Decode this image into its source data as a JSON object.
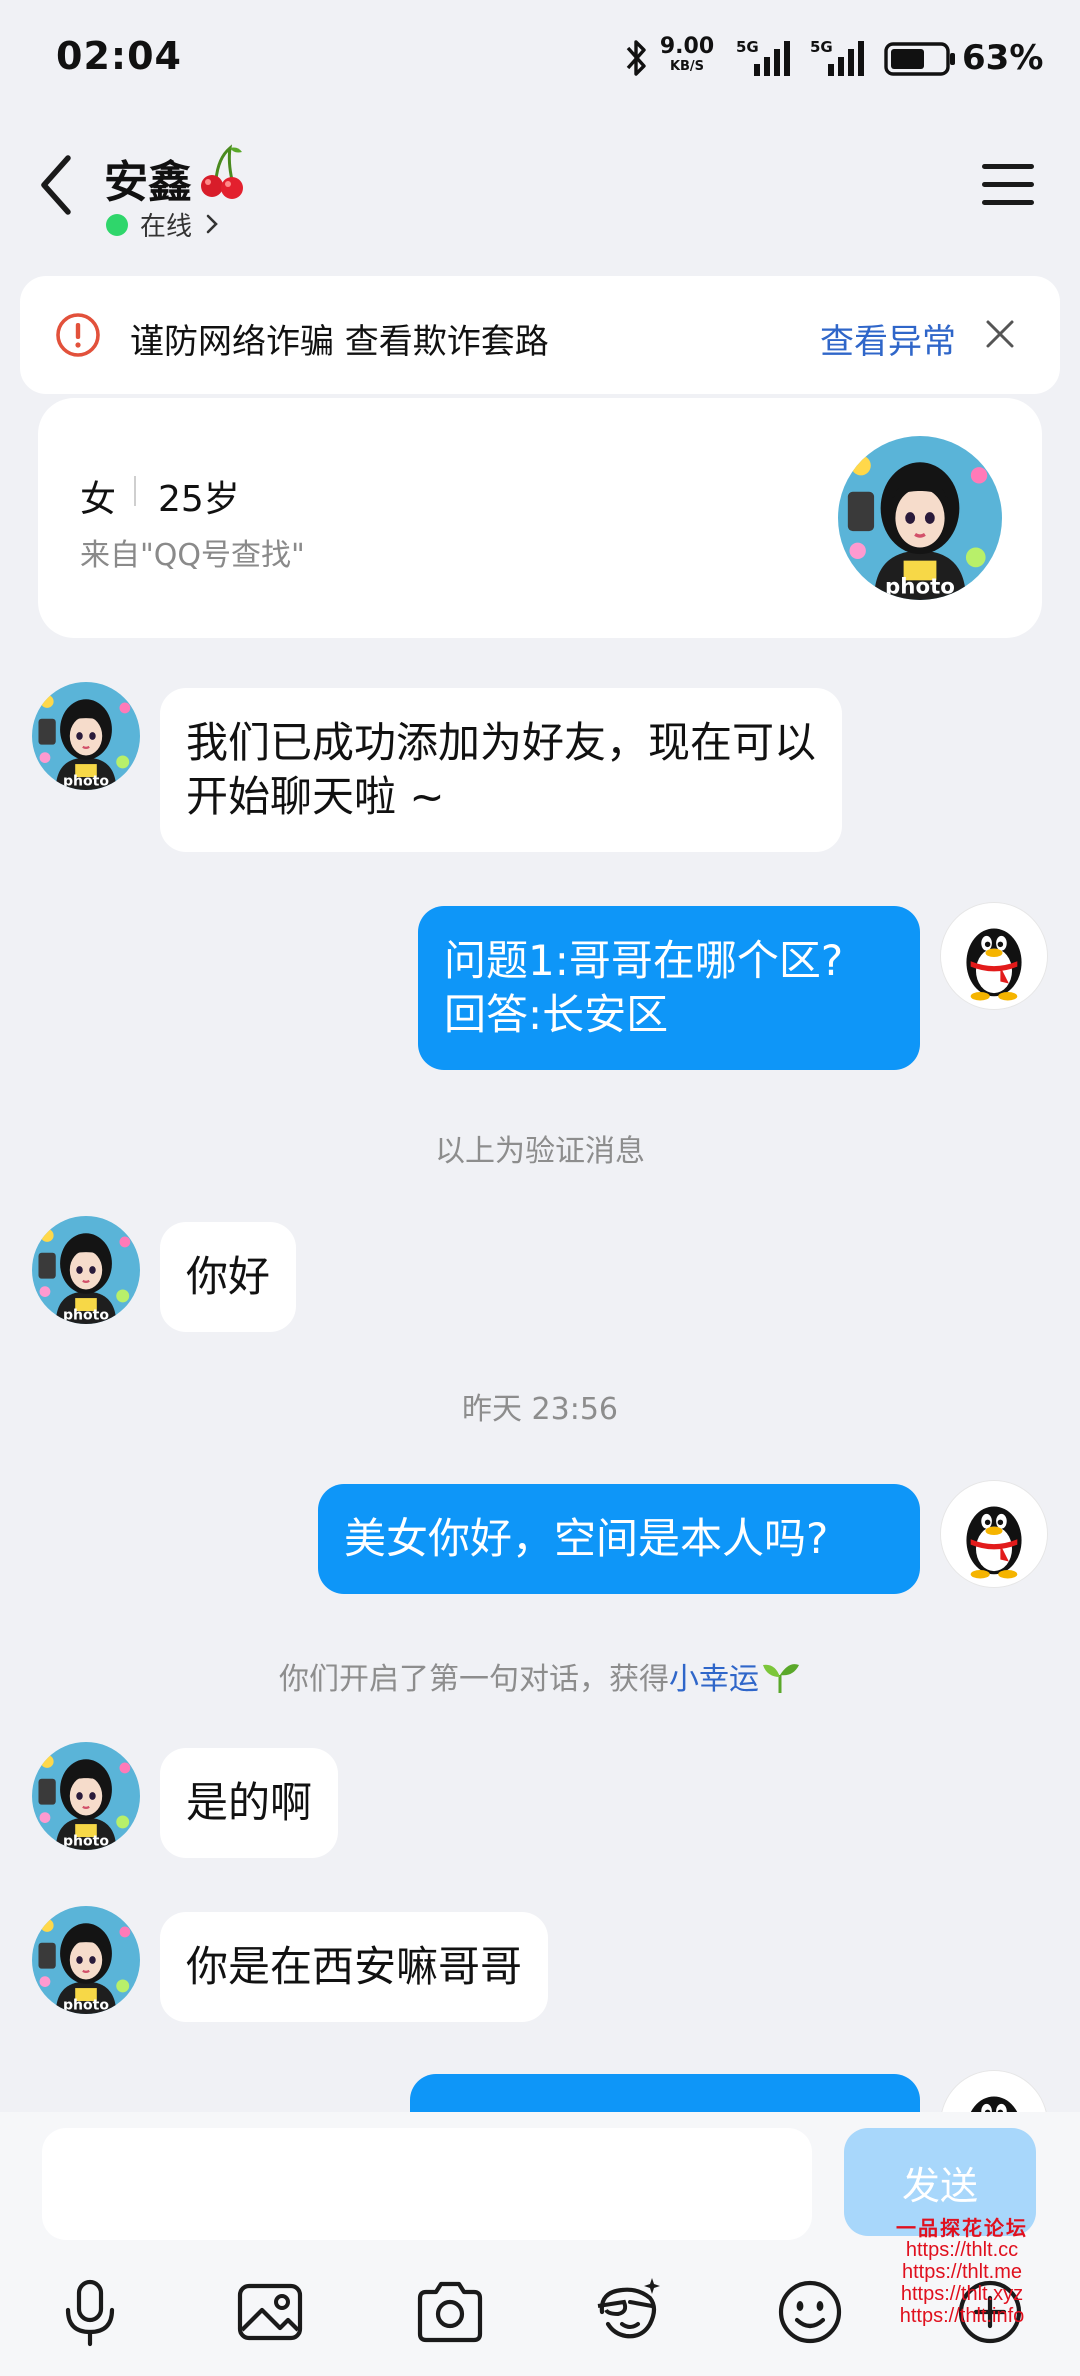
{
  "status_bar": {
    "time": "02:04",
    "net_speed": "9.00",
    "net_unit": "KB/S",
    "sim1": "5G",
    "sim2": "5G",
    "battery_level": 0.63,
    "battery_pct": "63%"
  },
  "header": {
    "contact_name": "安鑫",
    "name_emoji_icon": "cherry-icon",
    "online_status": "在线"
  },
  "fraud_banner": {
    "text": "谨防网络诈骗 查看欺诈套路",
    "link": "查看异常"
  },
  "profile": {
    "gender": "女",
    "age": "25岁",
    "source": "来自\"QQ号查找\""
  },
  "messages": {
    "m1": "我们已成功添加为好友，现在可以",
    "m1b": "开始聊天啦 ~",
    "m2": "问题1:哥哥在哪个区?",
    "m2b": "回答:长安区",
    "sys1": "以上为验证消息",
    "m3": "你好",
    "time1": "昨天 23:56",
    "m4": "美女你好，空间是本人吗?",
    "sys2": "你们开启了第一句对话，获得",
    "sys2_link": "小幸运",
    "m5": "是的啊",
    "m6": "你是在西安嘛哥哥"
  },
  "input": {
    "placeholder": "",
    "send_label": "发送"
  },
  "toolbar": [
    "mic-icon",
    "image-icon",
    "camera-icon",
    "sticker-icon",
    "emoji-icon",
    "plus-icon"
  ],
  "watermark": {
    "title": "一品探花论坛",
    "urls": [
      "https://thlt.cc",
      "https://thlt.me",
      "https://thlt.xyz",
      "https://thlt.info"
    ]
  },
  "colors": {
    "background": "#f0f1f5",
    "outgoing_bubble": "#0e96f8",
    "link": "#2f66c9",
    "online": "#2fd66b",
    "send_disabled": "#a8d7fb"
  }
}
